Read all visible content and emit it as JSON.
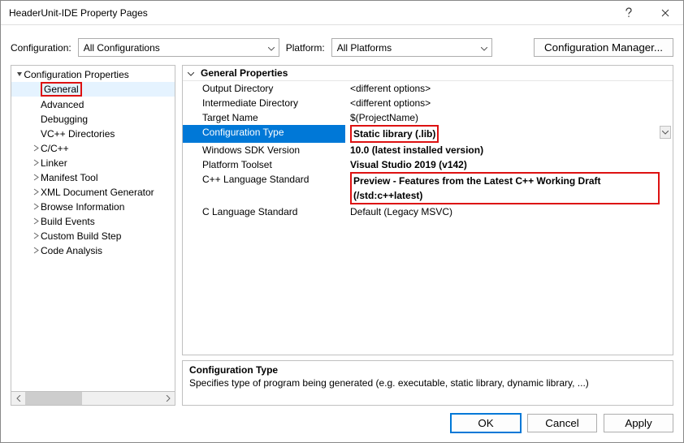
{
  "titlebar": {
    "title": "HeaderUnit-IDE Property Pages"
  },
  "toolbar": {
    "config_label": "Configuration:",
    "config_value": "All Configurations",
    "platform_label": "Platform:",
    "platform_value": "All Platforms",
    "cfg_manager": "Configuration Manager..."
  },
  "tree": {
    "root": "Configuration Properties",
    "items": [
      {
        "label": "General",
        "selected": true,
        "highlighted": true
      },
      {
        "label": "Advanced"
      },
      {
        "label": "Debugging"
      },
      {
        "label": "VC++ Directories"
      },
      {
        "label": "C/C++",
        "expandable": true
      },
      {
        "label": "Linker",
        "expandable": true
      },
      {
        "label": "Manifest Tool",
        "expandable": true
      },
      {
        "label": "XML Document Generator",
        "expandable": true
      },
      {
        "label": "Browse Information",
        "expandable": true
      },
      {
        "label": "Build Events",
        "expandable": true
      },
      {
        "label": "Custom Build Step",
        "expandable": true
      },
      {
        "label": "Code Analysis",
        "expandable": true
      }
    ]
  },
  "grid": {
    "header": "General Properties",
    "rows": [
      {
        "name": "Output Directory",
        "value": "<different options>"
      },
      {
        "name": "Intermediate Directory",
        "value": "<different options>"
      },
      {
        "name": "Target Name",
        "value": "$(ProjectName)"
      },
      {
        "name": "Configuration Type",
        "value": "Static library (.lib)",
        "selected": true,
        "bold": true,
        "highlight_value": true,
        "dropdown": true
      },
      {
        "name": "Windows SDK Version",
        "value": "10.0 (latest installed version)",
        "bold": true
      },
      {
        "name": "Platform Toolset",
        "value": "Visual Studio 2019 (v142)",
        "bold": true
      },
      {
        "name": "C++ Language Standard",
        "value": "Preview - Features from the Latest C++ Working Draft (/std:c++latest)",
        "bold": true,
        "highlight_value": true
      },
      {
        "name": "C Language Standard",
        "value": "Default (Legacy MSVC)"
      }
    ]
  },
  "description": {
    "title": "Configuration Type",
    "text": "Specifies type of program being generated (e.g. executable, static library, dynamic library, ...)"
  },
  "buttons": {
    "ok": "OK",
    "cancel": "Cancel",
    "apply": "Apply"
  }
}
